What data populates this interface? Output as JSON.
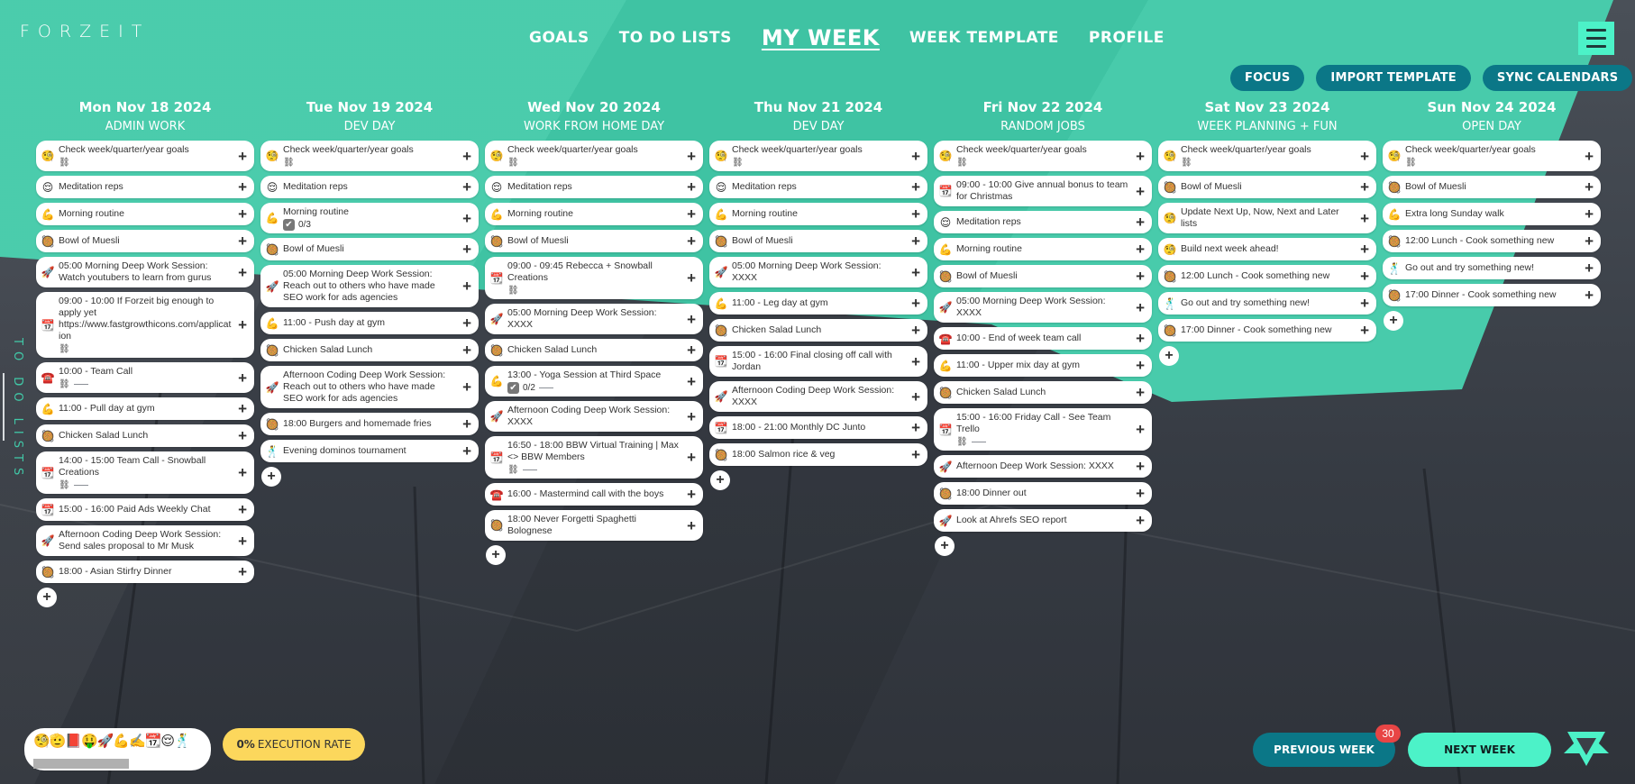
{
  "app": {
    "name": "FORZEIT"
  },
  "nav": {
    "items": [
      {
        "label": "GOALS",
        "active": false
      },
      {
        "label": "TO DO LISTS",
        "active": false
      },
      {
        "label": "MY WEEK",
        "active": true
      },
      {
        "label": "WEEK TEMPLATE",
        "active": false
      },
      {
        "label": "PROFILE",
        "active": false
      }
    ],
    "menu_icon": "hamburger-icon"
  },
  "actions": {
    "focus": "FOCUS",
    "import_template": "IMPORT TEMPLATE",
    "sync_calendars": "SYNC CALENDARS"
  },
  "side_tab": {
    "label": "TO DO LISTS"
  },
  "icons": {
    "goal": "🧐",
    "meditation": "😌",
    "muscle": "💪",
    "food": "🥘",
    "rocket": "🚀",
    "calendar": "📆",
    "phone": "☎️",
    "dance": "🕺",
    "link": "⛓",
    "check": "✔"
  },
  "days": [
    {
      "date": "Mon Nov 18 2024",
      "theme": "ADMIN WORK",
      "tasks": [
        {
          "icon": "goal",
          "title": "Check week/quarter/year goals",
          "link": true
        },
        {
          "icon": "meditation",
          "title": "Meditation reps"
        },
        {
          "icon": "muscle",
          "title": "Morning routine"
        },
        {
          "icon": "food",
          "title": "Bowl of Muesli"
        },
        {
          "icon": "rocket",
          "title": "05:00  Morning Deep Work Session: Watch youtubers to learn from gurus"
        },
        {
          "icon": "calendar",
          "title": "09:00 - 10:00 If Forzeit big enough to apply yet https://www.fastgrowthicons.com/application",
          "link": true
        },
        {
          "icon": "phone",
          "title": "10:00 - Team Call",
          "link": true,
          "dash": true
        },
        {
          "icon": "muscle",
          "title": "11:00 - Pull day at gym"
        },
        {
          "icon": "food",
          "title": "Chicken Salad Lunch"
        },
        {
          "icon": "calendar",
          "title": "14:00 - 15:00 Team Call - Snowball Creations",
          "link": true,
          "dash": true
        },
        {
          "icon": "calendar",
          "title": "15:00 - 16:00 Paid Ads Weekly Chat"
        },
        {
          "icon": "rocket",
          "title": "Afternoon Coding Deep Work Session: Send sales proposal to Mr Musk"
        },
        {
          "icon": "food",
          "title": "18:00 - Asian Stirfry Dinner"
        }
      ]
    },
    {
      "date": "Tue Nov 19 2024",
      "theme": "DEV DAY",
      "tasks": [
        {
          "icon": "goal",
          "title": "Check week/quarter/year goals",
          "link": true
        },
        {
          "icon": "meditation",
          "title": "Meditation reps"
        },
        {
          "icon": "muscle",
          "title": "Morning routine",
          "checklist": "0/3"
        },
        {
          "icon": "food",
          "title": "Bowl of Muesli"
        },
        {
          "icon": "rocket",
          "title": "05:00  Morning Deep Work Session: Reach out to others who have made SEO work for ads agencies"
        },
        {
          "icon": "muscle",
          "title": "11:00 - Push day at gym"
        },
        {
          "icon": "food",
          "title": "Chicken Salad Lunch"
        },
        {
          "icon": "rocket",
          "title": "Afternoon Coding Deep Work Session: Reach out to others who have made SEO work for ads agencies"
        },
        {
          "icon": "food",
          "title": "18:00  Burgers and homemade fries"
        },
        {
          "icon": "dance",
          "title": "Evening dominos tournament"
        }
      ]
    },
    {
      "date": "Wed Nov 20 2024",
      "theme": "WORK FROM HOME DAY",
      "tasks": [
        {
          "icon": "goal",
          "title": "Check week/quarter/year goals",
          "link": true
        },
        {
          "icon": "meditation",
          "title": "Meditation reps"
        },
        {
          "icon": "muscle",
          "title": "Morning routine"
        },
        {
          "icon": "food",
          "title": "Bowl of Muesli"
        },
        {
          "icon": "calendar",
          "title": "09:00 - 09:45  Rebecca + Snowball Creations",
          "link": true
        },
        {
          "icon": "rocket",
          "title": "05:00  Morning Deep Work Session: XXXX"
        },
        {
          "icon": "food",
          "title": "Chicken Salad Lunch"
        },
        {
          "icon": "muscle",
          "title": "13:00 - Yoga Session at Third Space",
          "checklist": "0/2",
          "dash": true
        },
        {
          "icon": "rocket",
          "title": "Afternoon Coding Deep Work Session: XXXX"
        },
        {
          "icon": "calendar",
          "title": "16:50 - 18:00 BBW Virtual Training | Max <> BBW Members",
          "link": true,
          "dash": true
        },
        {
          "icon": "phone",
          "title": "16:00 - Mastermind call with the boys"
        },
        {
          "icon": "food",
          "title": "18:00  Never Forgetti Spaghetti Bolognese"
        }
      ]
    },
    {
      "date": "Thu Nov 21 2024",
      "theme": "DEV DAY",
      "tasks": [
        {
          "icon": "goal",
          "title": "Check week/quarter/year goals",
          "link": true
        },
        {
          "icon": "meditation",
          "title": "Meditation reps"
        },
        {
          "icon": "muscle",
          "title": "Morning routine"
        },
        {
          "icon": "food",
          "title": "Bowl of Muesli"
        },
        {
          "icon": "rocket",
          "title": "05:00  Morning Deep Work Session: XXXX"
        },
        {
          "icon": "muscle",
          "title": "11:00 - Leg day at gym"
        },
        {
          "icon": "food",
          "title": "Chicken Salad Lunch"
        },
        {
          "icon": "calendar",
          "title": "15:00 - 16:00 Final closing off call with Jordan"
        },
        {
          "icon": "rocket",
          "title": "Afternoon Coding Deep Work Session: XXXX"
        },
        {
          "icon": "calendar",
          "title": "18:00 - 21:00 Monthly DC Junto"
        },
        {
          "icon": "food",
          "title": "18:00  Salmon rice & veg"
        }
      ]
    },
    {
      "date": "Fri Nov 22 2024",
      "theme": "RANDOM JOBS",
      "tasks": [
        {
          "icon": "goal",
          "title": "Check week/quarter/year goals",
          "link": true
        },
        {
          "icon": "calendar",
          "title": "09:00 - 10:00 Give annual bonus to team for Christmas"
        },
        {
          "icon": "meditation",
          "title": "Meditation reps"
        },
        {
          "icon": "muscle",
          "title": "Morning routine"
        },
        {
          "icon": "food",
          "title": "Bowl of Muesli"
        },
        {
          "icon": "rocket",
          "title": "05:00  Morning Deep Work Session: XXXX"
        },
        {
          "icon": "phone",
          "title": "10:00 - End of week team call"
        },
        {
          "icon": "muscle",
          "title": "11:00 - Upper mix day at gym"
        },
        {
          "icon": "food",
          "title": "Chicken Salad Lunch"
        },
        {
          "icon": "calendar",
          "title": "15:00 - 16:00 Friday Call - See Team Trello",
          "link": true,
          "dash": true
        },
        {
          "icon": "rocket",
          "title": "Afternoon Deep Work Session: XXXX"
        },
        {
          "icon": "food",
          "title": "18:00  Dinner out"
        },
        {
          "icon": "rocket",
          "title": "Look at Ahrefs SEO report"
        }
      ]
    },
    {
      "date": "Sat Nov 23 2024",
      "theme": "WEEK PLANNING + FUN",
      "tasks": [
        {
          "icon": "goal",
          "title": "Check week/quarter/year goals",
          "link": true
        },
        {
          "icon": "food",
          "title": "Bowl of Muesli"
        },
        {
          "icon": "goal",
          "title": "Update Next Up, Now, Next and Later lists"
        },
        {
          "icon": "goal",
          "title": "Build next week ahead!"
        },
        {
          "icon": "food",
          "title": "12:00  Lunch - Cook something new"
        },
        {
          "icon": "dance",
          "title": "Go out and try something new!"
        },
        {
          "icon": "food",
          "title": "17:00  Dinner - Cook something new"
        }
      ]
    },
    {
      "date": "Sun Nov 24 2024",
      "theme": "OPEN DAY",
      "tasks": [
        {
          "icon": "goal",
          "title": "Check week/quarter/year goals",
          "link": true
        },
        {
          "icon": "food",
          "title": "Bowl of Muesli"
        },
        {
          "icon": "muscle",
          "title": "Extra long Sunday walk"
        },
        {
          "icon": "food",
          "title": "12:00  Lunch - Cook something new"
        },
        {
          "icon": "dance",
          "title": "Go out and try something new!"
        },
        {
          "icon": "food",
          "title": "17:00  Dinner - Cook something new"
        }
      ]
    }
  ],
  "footer": {
    "emoji_tray": "🧐🫡📕🤑🚀💪✍️📆😌🕺",
    "execution_rate": {
      "value": "0%",
      "label": "EXECUTION RATE"
    },
    "previous_week": "PREVIOUS WEEK",
    "previous_week_badge": "30",
    "next_week": "NEXT WEEK"
  },
  "colors": {
    "teal_bg": "#41c9a8",
    "dark_teal_button": "#0b7787",
    "mint_button": "#4cf2c8",
    "yellow_pill": "#fcd75c",
    "badge_red": "#e84545"
  }
}
